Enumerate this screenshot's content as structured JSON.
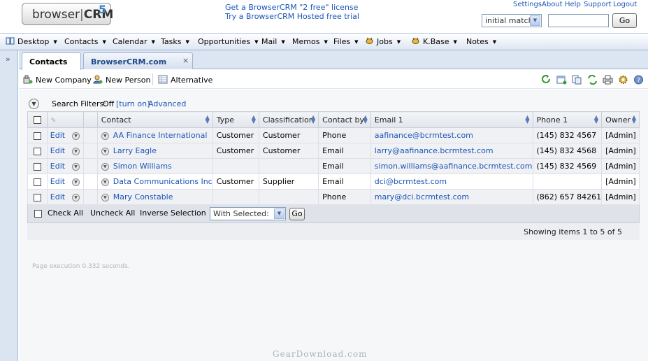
{
  "header": {
    "logo_text": "browser",
    "logo_bold": "CRM",
    "logo_version": "5",
    "promo1": "Get a BrowserCRM \"2 free\" license",
    "promo2": "Try a BrowserCRM Hosted free trial",
    "links": [
      "Settings",
      "About",
      "Help",
      "Support",
      "Logout"
    ],
    "match_select": "initial match",
    "search_value": "",
    "go_label": "Go"
  },
  "nav": {
    "items": [
      {
        "label": "Desktop",
        "icon": "book-icon"
      },
      {
        "label": "Contacts"
      },
      {
        "label": "Calendar"
      },
      {
        "label": "Tasks"
      },
      {
        "label": "Opportunities"
      },
      {
        "label": "Mail"
      },
      {
        "label": "Memos"
      },
      {
        "label": "Files"
      },
      {
        "label": "Jobs",
        "icon": "bee-icon"
      },
      {
        "label": "K.Base",
        "icon": "bee-icon"
      },
      {
        "label": "Notes"
      }
    ]
  },
  "rail": {
    "expand": "»"
  },
  "tabs": [
    {
      "label": "Contacts",
      "active": true
    },
    {
      "label": "BrowserCRM.com",
      "active": false,
      "close": "×"
    }
  ],
  "toolbar": {
    "new_company": "New Company",
    "new_person": "New Person",
    "alternative": "Alternative",
    "actions": [
      "refresh-icon",
      "add-window-icon",
      "copy-icon",
      "sync-icon",
      "print-icon",
      "settings-icon",
      "help-icon"
    ]
  },
  "filters": {
    "label": "Search Filters:",
    "state": "Off",
    "turn_on": "[turn on]",
    "advanced": "Advanced"
  },
  "table": {
    "columns": [
      "Contact",
      "Type",
      "Classification",
      "Contact by",
      "Email 1",
      "Phone 1",
      "Owner"
    ],
    "rows": [
      {
        "edit": "Edit",
        "contact": "AA Finance International",
        "type": "Customer",
        "classification": "Customer",
        "contact_by": "Phone",
        "email": "aafinance@bcrmtest.com",
        "phone": "(145) 832 4567",
        "owner": "[Admin]"
      },
      {
        "edit": "Edit",
        "contact": "Larry Eagle",
        "type": "Customer",
        "classification": "Customer",
        "contact_by": "Email",
        "email": "larry@aafinance.bcrmtest.com",
        "phone": "(145) 832 4568",
        "owner": "[Admin]"
      },
      {
        "edit": "Edit",
        "contact": "Simon Williams",
        "type": "",
        "classification": "",
        "contact_by": "Email",
        "email": "simon.williams@aafinance.bcrmtest.com",
        "phone": "(145) 832 4569",
        "owner": "[Admin]"
      },
      {
        "edit": "Edit",
        "contact": "Data Communications Inc",
        "type": "Customer",
        "classification": "Supplier",
        "contact_by": "Email",
        "email": "dci@bcrmtest.com",
        "phone": "",
        "owner": "[Admin]"
      },
      {
        "edit": "Edit",
        "contact": "Mary Constable",
        "type": "",
        "classification": "",
        "contact_by": "Phone",
        "email": "mary@dci.bcrmtest.com",
        "phone": "(862) 657 84261",
        "owner": "[Admin]"
      }
    ]
  },
  "bulk": {
    "check_all": "Check All",
    "uncheck_all": "Uncheck All",
    "inverse": "Inverse Selection",
    "with_selected": "With Selected:",
    "go_label": "Go"
  },
  "pager": {
    "text": "Showing items 1 to 5 of 5"
  },
  "footer": {
    "exec_time": "Page execution 0.332 seconds."
  },
  "watermark": "GearDownload.com"
}
